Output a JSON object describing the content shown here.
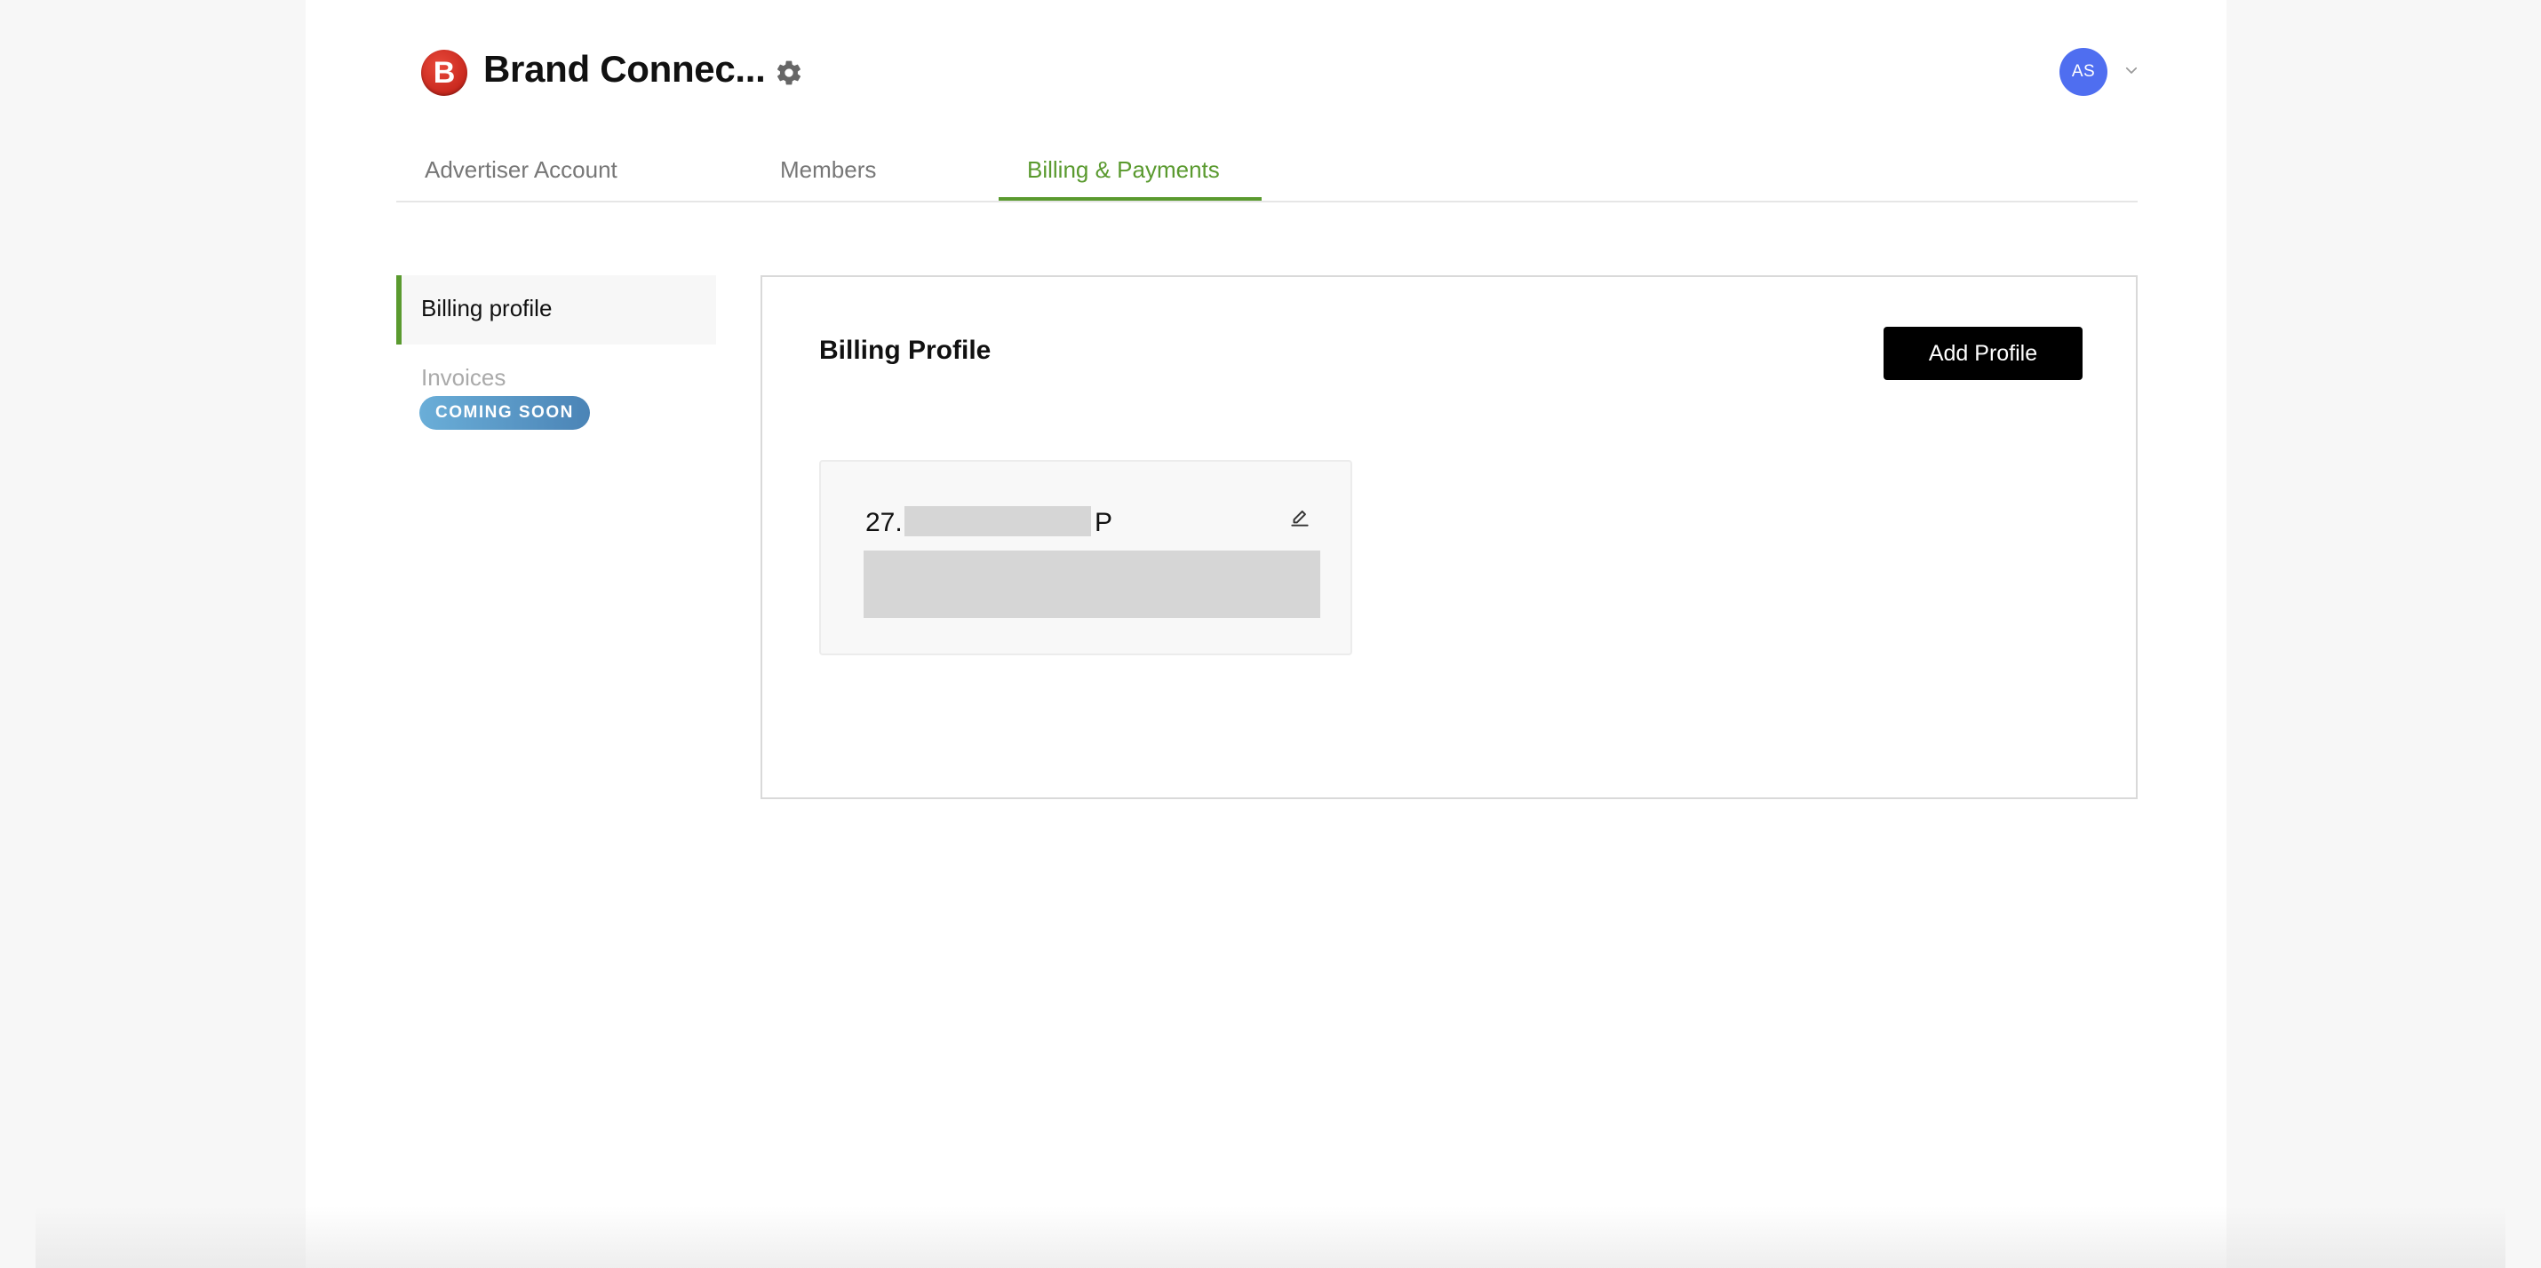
{
  "header": {
    "brand_logo_letter": "B",
    "brand_title": "Brand Connec...",
    "settings_icon": "gear-icon",
    "avatar_initials": "AS",
    "avatar_menu_icon": "chevron-down-icon"
  },
  "tabs": [
    {
      "label": "Advertiser Account"
    },
    {
      "label": "Members"
    },
    {
      "label": "Billing & Payments",
      "active": true
    }
  ],
  "sidebar": {
    "items": [
      {
        "label": "Billing profile",
        "active": true
      },
      {
        "label": "Invoices",
        "badge": "COMING SOON",
        "disabled": true
      }
    ]
  },
  "main": {
    "title": "Billing Profile",
    "add_button_label": "Add Profile",
    "profile_card": {
      "name_prefix": "27.",
      "name_suffix": "P",
      "edit_icon": "pencil-icon"
    }
  },
  "colors": {
    "accent": "#5a9a2f",
    "avatar": "#4f6ef0",
    "brand_logo": "#d12f22",
    "badge": "#5a9ccb"
  }
}
